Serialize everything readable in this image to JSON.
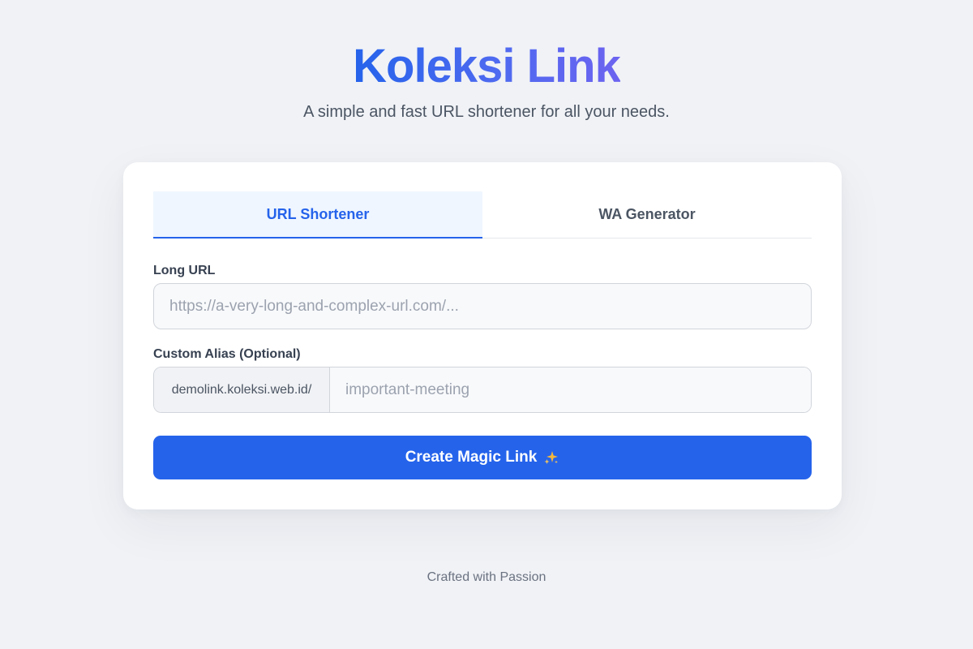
{
  "header": {
    "title": "Koleksi Link",
    "subtitle": "A simple and fast URL shortener for all your needs."
  },
  "tabs": [
    {
      "label": "URL Shortener",
      "active": true
    },
    {
      "label": "WA Generator",
      "active": false
    }
  ],
  "form": {
    "long_url": {
      "label": "Long URL",
      "placeholder": "https://a-very-long-and-complex-url.com/...",
      "value": ""
    },
    "alias": {
      "label": "Custom Alias (Optional)",
      "prefix": "demolink.koleksi.web.id/",
      "placeholder": "important-meeting",
      "value": ""
    },
    "submit_label": "Create Magic Link",
    "submit_icon": "sparkles-icon"
  },
  "footer": {
    "text": "Crafted with Passion"
  },
  "colors": {
    "accent": "#2563eb",
    "background": "#f0f2f6",
    "card": "#ffffff",
    "active_tab_bg": "#eff6ff",
    "sparkle": "#f5b83d"
  }
}
